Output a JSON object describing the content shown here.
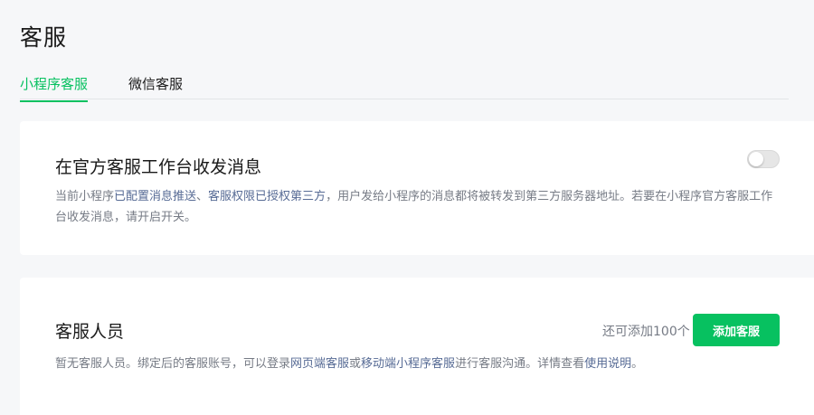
{
  "page": {
    "title": "客服"
  },
  "tabs": [
    {
      "label": "小程序客服",
      "active": true
    },
    {
      "label": "微信客服",
      "active": false
    }
  ],
  "official_workbench": {
    "title": "在官方客服工作台收发消息",
    "toggle_on": false,
    "desc": {
      "t1": "当前小程序",
      "l1": "已配置消息推送",
      "t2": "、",
      "l2": "客服权限已授权第三方",
      "t3": "，用户发给小程序的消息都将被转发到第三方服务器地址。若要在小程序官方客服工作台收发消息，请开启开关。"
    }
  },
  "service_staff": {
    "title": "客服人员",
    "remaining": "还可添加100个",
    "add_button": "添加客服",
    "desc": {
      "t1": "暂无客服人员。绑定后的客服账号，可以登录",
      "l1": "网页端客服",
      "t2": "或",
      "l2": "移动端小程序客服",
      "t3": "进行客服沟通。详情查看",
      "l3": "使用说明",
      "t4": "。"
    }
  },
  "colors": {
    "accent": "#07c160",
    "link": "#576b95",
    "muted": "#767b85"
  }
}
